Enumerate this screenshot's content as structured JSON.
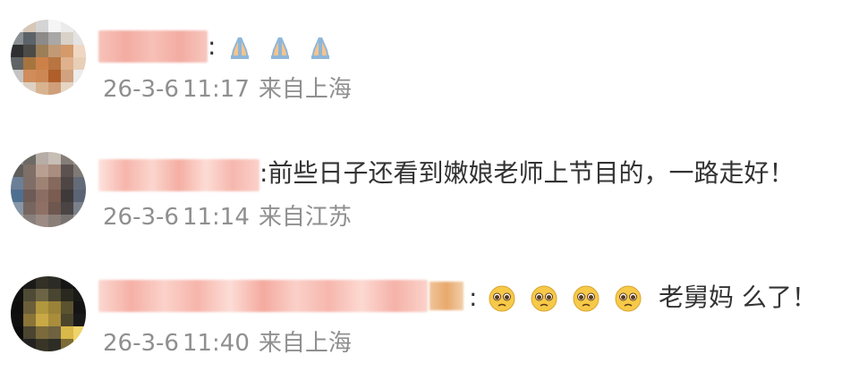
{
  "comments": [
    {
      "username": "",
      "separator": ":",
      "body_text": "",
      "emoji_icons": [
        "folded-hands-icon",
        "folded-hands-icon",
        "folded-hands-icon"
      ],
      "date": "26-3-6",
      "time": "11:17",
      "location": "来自上海"
    },
    {
      "username": "",
      "separator": ":",
      "body_text": "前些日子还看到嫩娘老师上节目的，一路走好！",
      "emoji_icons": [],
      "date": "26-3-6",
      "time": "11:14",
      "location": "来自江苏"
    },
    {
      "username": "",
      "separator": ":",
      "body_text": "老舅妈 么了！",
      "emoji_icons": [
        "pleading-face-icon",
        "pleading-face-icon",
        "pleading-face-icon",
        "pleading-face-icon"
      ],
      "date": "26-3-6",
      "time": "11:40",
      "location": "来自上海"
    }
  ],
  "colors": {
    "username_blur": "#f3a59c",
    "meta_text": "#8f8f8f",
    "body_text": "#333333"
  }
}
